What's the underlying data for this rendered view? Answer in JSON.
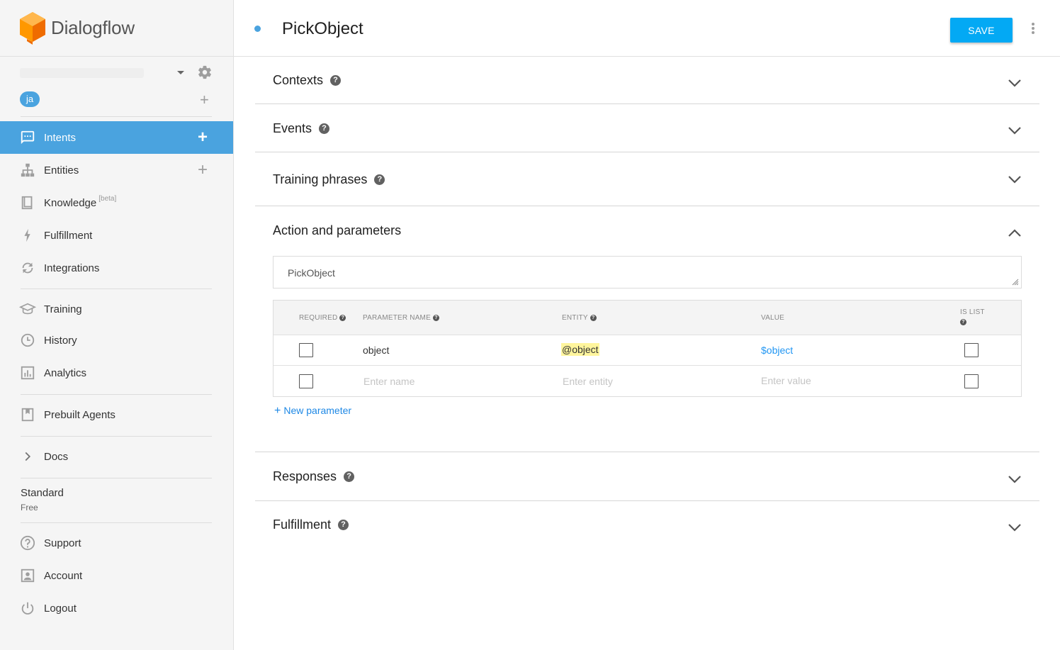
{
  "brand": {
    "name": "Dialogflow"
  },
  "sidebar": {
    "language": "ja",
    "nav_primary": [
      {
        "label": "Intents",
        "icon": "chat-bubble-icon"
      },
      {
        "label": "Entities",
        "icon": "hierarchy-icon"
      },
      {
        "label": "Knowledge",
        "badge": "[beta]",
        "icon": "book-icon"
      },
      {
        "label": "Fulfillment",
        "icon": "lightning-icon"
      },
      {
        "label": "Integrations",
        "icon": "sync-icon"
      }
    ],
    "nav_secondary": [
      {
        "label": "Training",
        "icon": "graduation-cap-icon"
      },
      {
        "label": "History",
        "icon": "clock-icon"
      },
      {
        "label": "Analytics",
        "icon": "bar-chart-icon"
      }
    ],
    "prebuilt": {
      "label": "Prebuilt Agents",
      "icon": "bookmark-book-icon"
    },
    "docs": {
      "label": "Docs",
      "icon": "chevron-right-icon"
    },
    "plan": {
      "name": "Standard",
      "tier": "Free"
    },
    "nav_bottom": [
      {
        "label": "Support",
        "icon": "help-circle-icon"
      },
      {
        "label": "Account",
        "icon": "account-box-icon"
      },
      {
        "label": "Logout",
        "icon": "power-icon"
      }
    ]
  },
  "header": {
    "intent_name": "PickObject",
    "save_label": "SAVE"
  },
  "sections": {
    "contexts": "Contexts",
    "events": "Events",
    "training": "Training phrases",
    "action": "Action and parameters",
    "responses": "Responses",
    "fulfillment": "Fulfillment"
  },
  "action": {
    "name": "PickObject",
    "columns": {
      "required": "REQUIRED",
      "param_name": "PARAMETER NAME",
      "entity": "ENTITY",
      "value": "VALUE",
      "is_list": "IS LIST"
    },
    "rows": [
      {
        "required": false,
        "name": "object",
        "entity": "@object",
        "value": "$object",
        "is_list": false
      }
    ],
    "placeholders": {
      "name": "Enter name",
      "entity": "Enter entity",
      "value": "Enter value"
    },
    "new_parameter": "New parameter"
  },
  "colors": {
    "accent": "#4aa3df",
    "save": "#03a9f4",
    "link": "#2196f3",
    "highlight": "#fff59d"
  }
}
